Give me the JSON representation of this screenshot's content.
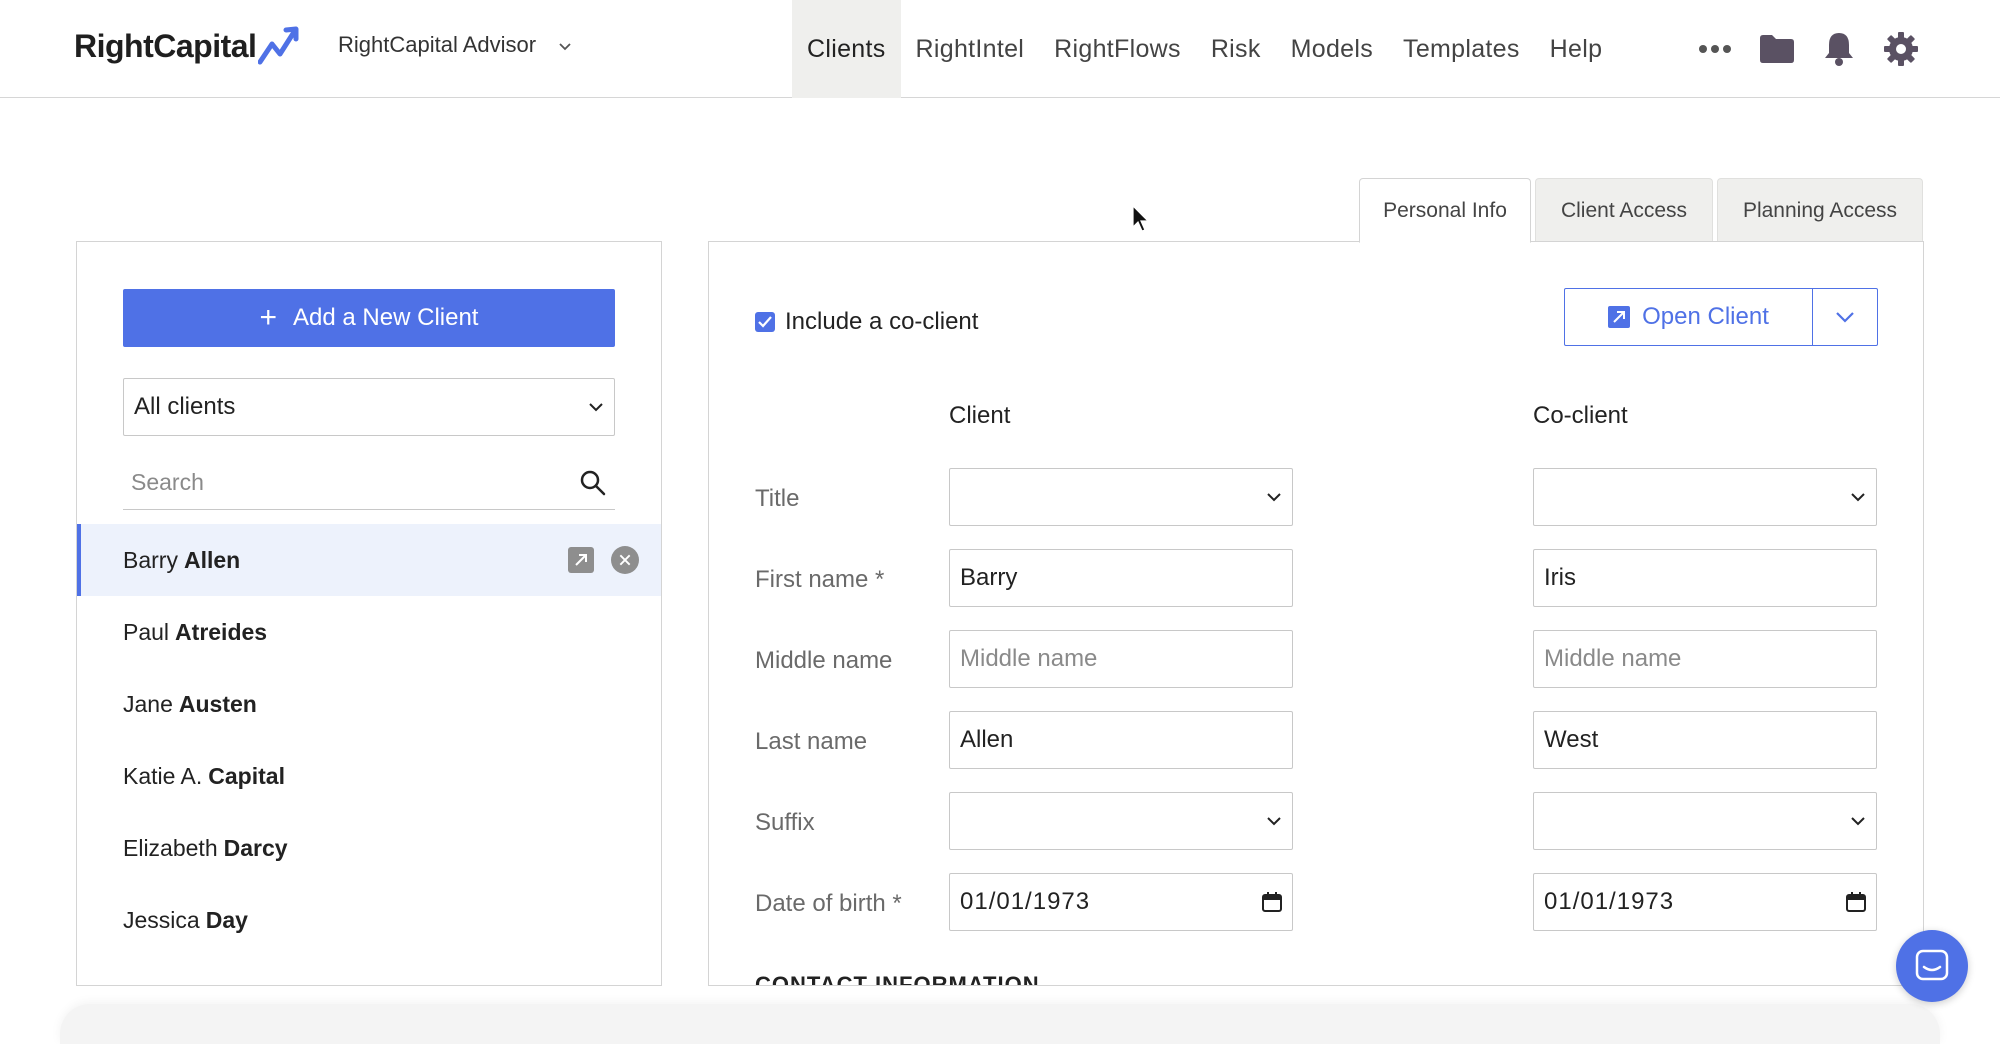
{
  "header": {
    "logo_text": "RightCapital",
    "advisor": "RightCapital Advisor",
    "nav": [
      "Clients",
      "RightIntel",
      "RightFlows",
      "Risk",
      "Models",
      "Templates",
      "Help"
    ],
    "icons": [
      "more-icon",
      "folder-icon",
      "bell-icon",
      "gear-icon"
    ]
  },
  "tabs": [
    "Personal Info",
    "Client Access",
    "Planning Access"
  ],
  "sidebar": {
    "add_button": "Add a New Client",
    "filter_value": "All clients",
    "search_placeholder": "Search",
    "clients": [
      {
        "first": "Barry",
        "last": "Allen"
      },
      {
        "first": "Paul",
        "last": "Atreides"
      },
      {
        "first": "Jane",
        "last": "Austen"
      },
      {
        "first": "Katie A.",
        "last": "Capital"
      },
      {
        "first": "Elizabeth",
        "last": "Darcy"
      },
      {
        "first": "Jessica",
        "last": "Day"
      }
    ]
  },
  "form": {
    "coclient_label": "Include a co-client",
    "open_client": "Open Client",
    "col_client": "Client",
    "col_coclient": "Co-client",
    "labels": {
      "title": "Title",
      "first_name": "First name *",
      "middle_name": "Middle name",
      "last_name": "Last name",
      "suffix": "Suffix",
      "dob": "Date of birth *"
    },
    "client": {
      "title": "",
      "first_name": "Barry",
      "middle_name_placeholder": "Middle name",
      "last_name": "Allen",
      "suffix": "",
      "dob": "01/01/1973"
    },
    "coclient": {
      "title": "",
      "first_name": "Iris",
      "middle_name_placeholder": "Middle name",
      "last_name": "West",
      "suffix": "",
      "dob": "01/01/1973"
    },
    "section_contact": "CONTACT INFORMATION"
  },
  "colors": {
    "accent": "#4f71e6",
    "nav_active_bg": "#efefed"
  }
}
